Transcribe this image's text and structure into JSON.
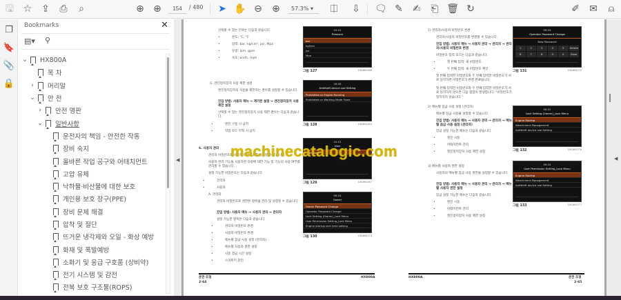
{
  "toolbar": {
    "icons": [
      "save-icon",
      "star-icon",
      "upload-icon",
      "print-icon",
      "find-icon",
      "prev-page-icon",
      "next-page-icon",
      "select-cursor-icon",
      "hand-icon",
      "zoom-out-icon",
      "zoom-in-icon",
      "fit-page-icon",
      "scroll-mode-icon",
      "comment-icon",
      "highlight-icon",
      "sign-icon",
      "stamp-icon",
      "delete-icon",
      "rotate-icon",
      "edit-sign-icon",
      "mail-icon",
      "account-icon"
    ],
    "page_current": "154",
    "page_total": "/ 480",
    "zoom": "57.3%",
    "zoom_caret": "▾"
  },
  "bookmarks": {
    "title": "Bookmarks",
    "close": "✕",
    "items": [
      {
        "label": "HX800A",
        "level": 0,
        "chev": "⌄"
      },
      {
        "label": "목 차",
        "level": 1,
        "chev": ""
      },
      {
        "label": "머리말",
        "level": 1,
        "chev": "›"
      },
      {
        "label": "안 전",
        "level": 1,
        "chev": "⌄"
      },
      {
        "label": "안전 명판",
        "level": 2,
        "chev": "›"
      },
      {
        "label": "일반사항",
        "level": 2,
        "chev": "⌄"
      },
      {
        "label": "운전자의 책임 - 안전한 작동",
        "level": 3,
        "chev": ""
      },
      {
        "label": "장비 숙지",
        "level": 3,
        "chev": ""
      },
      {
        "label": "올바른 작업 공구와 어태치먼트",
        "level": 3,
        "chev": ""
      },
      {
        "label": "고압 유체",
        "level": 3,
        "chev": ""
      },
      {
        "label": "낙하물·비산물에 대한 보호",
        "level": 3,
        "chev": ""
      },
      {
        "label": "개인용 보호 장구(PPE)",
        "level": 3,
        "chev": ""
      },
      {
        "label": "장비 문제 해결",
        "level": 3,
        "chev": ""
      },
      {
        "label": "압착 및 절단",
        "level": 3,
        "chev": ""
      },
      {
        "label": "뜨거운 냉각제와 오일 - 화상 예방",
        "level": 3,
        "chev": ""
      },
      {
        "label": "화재 및 폭발예방",
        "level": 3,
        "chev": ""
      },
      {
        "label": "소화기 및 응급 구호품 (상비약)",
        "level": 3,
        "chev": ""
      },
      {
        "label": "전기 시스템 및 감전",
        "level": 3,
        "chev": ""
      },
      {
        "label": "전복 보호 구조물(ROPS)",
        "level": 3,
        "chev": ""
      }
    ]
  },
  "watermark": "machinecatalogic.com",
  "left_page": {
    "intro": "선택할 수 있는 단위는 다음과 같습니다.",
    "units": [
      "온도: °C, °F",
      "압력: bar, kg/cm², psi, Mpa",
      "유량: lpm, gpm",
      "속도: km/h, mph"
    ],
    "g_head": "G.  엔진정지장치 사용 제한 설정",
    "g_text": "엔진정지장치의 사용을 제한하는 경우를 설정할 수 있습니다.",
    "g_path": "진입 방법: 사용자 메뉴 → 계기판 설정 → 엔진정지장치 사용 제한 설정",
    "g_text2": "선택할 수 있는 엔진정지장치 사용 제한 경우는 다음과 같습니다.",
    "g_items": [
      "엔진 구동 시 금지",
      "작업 모드 부착 시 금지"
    ],
    "sec6_head": "6.  사용자 관리",
    "sec6_text1": "관리자 비밀번호로 사용자 비밀번호를 설정할 수 있습니다.",
    "sec6_text2": "사용자 관리 기능을 사용하면 차량에 대한 기능 및 기능의 사용 여부를 관리할 수 있습니다.",
    "sec6_text3": "설정 가능한 비밀번호는 다음과 같습니다.",
    "sec6_items": [
      "관리자",
      "사용자"
    ],
    "a_head": "A.  관리자",
    "a_text": "관리자 비밀번호로 권한된 항목을 관리 및 설정할 수 있습니다.",
    "a_path": "진입 방법: 사용자 메뉴 → 사용자 관리 → 관리자",
    "a_text2": "설정 가능한 항목은 다음과 같습니다.",
    "a_items": [
      "관리자 비밀번호 변경",
      "사용자 비밀번호 변경",
      "메뉴별 잠금 사용 설정 (관리자)",
      "메뉴별 사용자 권한 설정",
      "시동 잠금 시간 설정",
      "스마트키 관리"
    ],
    "figures": [
      {
        "caption": "그림 127",
        "code": "DS1600266",
        "time": "10:12",
        "title": "Pressure",
        "rows": [
          "bar",
          "kgf/cm",
          "psi",
          "Mpa"
        ]
      },
      {
        "caption": "그림 128",
        "code": "DS1601344",
        "time": "16:43",
        "title": "Antitheft device use Setting",
        "rows": [
          "Prohibited on Engine Running",
          "Prohibited on Working Mode Fixed"
        ]
      },
      {
        "caption": "그림 129",
        "code": "DS1600267",
        "time": "10:12",
        "title": "User",
        "rows": [
          "Operator"
        ]
      },
      {
        "caption": "그림 130",
        "code": "DS1600774",
        "time": "09:24",
        "title": "Owner",
        "rows": [
          "Owner Password Change",
          "Operator Password Change",
          "Lock Setting (Owner)_Lock Menu",
          "User Permission Setting_Lock Menu",
          "Engine startup lock time setting"
        ]
      }
    ],
    "footer_left": "운전 조정",
    "footer_page": "2-64",
    "footer_right": "HX800A"
  },
  "right_page": {
    "s1_head": "1)  관리자/사용자 비밀번호 변경",
    "s1_text": "관리자/사용자 비밀번호를 변경할 수 있습니다.",
    "s1_path": "진입 방법: 사용자 메뉴 → 사용자 관리 → 관리자 → 관리자/사용자 비밀번호 변경",
    "s1_text2": "비밀번호 입력 모드는 다음과 같습니다.",
    "s1_items": [
      "첫 번째 입력: 새 비밀번호",
      "두 번째 입력: 새 비밀번호 확인"
    ],
    "s1_text3": "첫 번째 입력한 비밀번호와 두 번째 입력한 비밀번호가 서로 일치하면 비밀번호가 변경 완료됩니다.",
    "s1_text4": "첫 번째 입력한 비밀번호와 두 번째 입력한 비밀번호가 서로 일치하지 않으면 다음 팝업이 발생합니다. \"비밀번호가 일치하지 않습니다.\"",
    "s2_head": "2)  메뉴별 잠금 사용 설정 (관리자)",
    "s2_text": "메뉴별 잠금 사용을 설정할 수 있습니다.",
    "s2_path": "진입 방법: 사용자 메뉴 → 사용자 관리 → 관리자 → 메뉴별 잠금 사용 설정 (관리자)",
    "s2_text2": "잠금 설정 가능한 메뉴는 다음과 같습니다.",
    "s2_items": [
      "엔진 시동",
      "어태치먼트 관리",
      "엔진정지장치 사용 제한 설정"
    ],
    "s3_head": "3)  메뉴별 사용자 권한 설정",
    "s3_text": "사용자의 메뉴별 잠금 사용 권한을 설정할 수 있습니다.",
    "s3_path": "진입 방법: 사용자 메뉴 → 사용자 관리 → 관리자 → 메뉴별 사용자 권한 설정",
    "s3_text2": "잠금 설정 가능한 메뉴는 다음과 같습니다.",
    "s3_items": [
      "엔진 시동",
      "어태치먼트 관리",
      "엔진정지장치 사용 제한 설정"
    ],
    "figures": [
      {
        "caption": "그림 131",
        "code": "DS1600775",
        "time": "09:24",
        "title": "Operator Password Change",
        "sub": "New Password",
        "keys": [
          "1",
          "2",
          "3",
          "4",
          "5",
          "Delete",
          "6",
          "7",
          "8",
          "9",
          "0",
          "Save"
        ]
      },
      {
        "caption": "그림 132",
        "code": "DS1600776",
        "time": "09:22",
        "title": "Lock Setting (Owner)_Lock Menu",
        "rows": [
          "Engine Startup",
          "Attachment Management",
          "Antitheft device use Setting"
        ]
      },
      {
        "caption": "그림 133",
        "code": "DS1600777",
        "time": "09:24",
        "title": "User Permission Setting_Lock Menu",
        "rows": [
          "Engine Startup",
          "Attachment Management",
          "Antitheft device use Setting"
        ]
      }
    ],
    "footer_left": "HX800A",
    "footer_right": "운전 조정",
    "footer_page": "2-65"
  }
}
